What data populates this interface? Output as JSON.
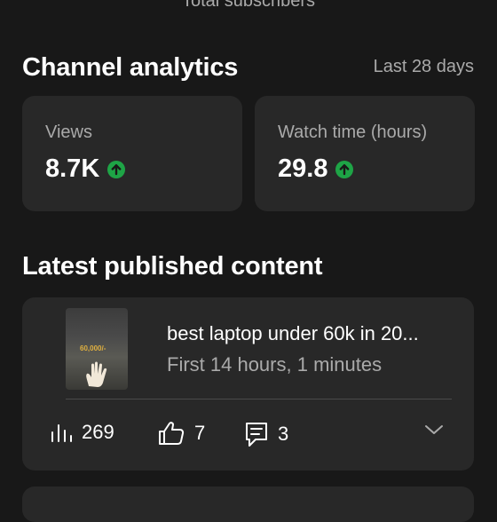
{
  "header": {
    "subscribers_label": "Total subscribers"
  },
  "analytics": {
    "title": "Channel analytics",
    "period": "Last 28 days",
    "views": {
      "label": "Views",
      "value": "8.7K",
      "trend": "up"
    },
    "watch_time": {
      "label": "Watch time (hours)",
      "value": "29.8",
      "trend": "up"
    }
  },
  "latest": {
    "title": "Latest published content",
    "video": {
      "title": "best laptop under 60k in 20...",
      "subtitle": "First 14 hours, 1 minutes",
      "thumbnail_text": "60,000/-",
      "views": "269",
      "likes": "7",
      "comments": "3"
    }
  },
  "colors": {
    "accent_up": "#1ea446",
    "background": "#181818",
    "card": "#282828"
  }
}
